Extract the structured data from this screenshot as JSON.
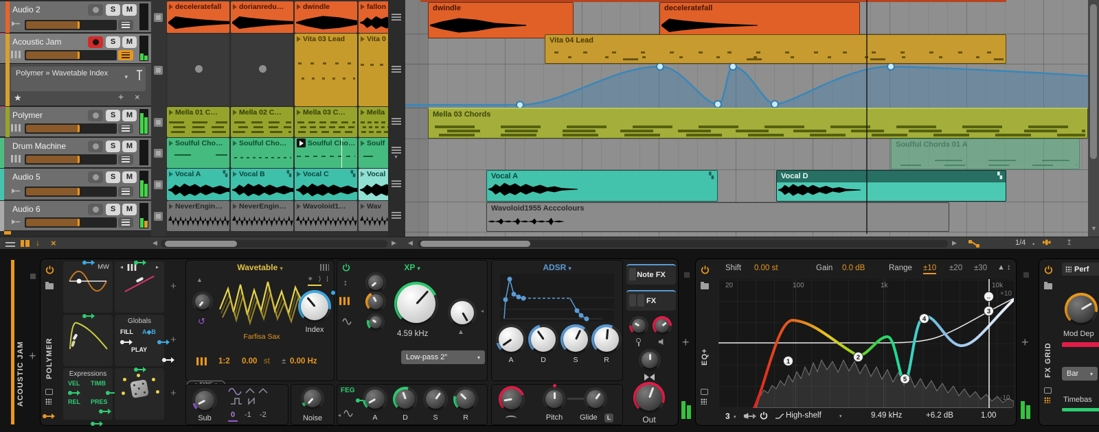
{
  "colors": {
    "accent_orange": "#e8981e",
    "accent_green": "#2ecc71",
    "accent_blue": "#3fa9e0",
    "accent_red": "#e11d48",
    "group_pink": "#d6336c",
    "track_audio2": "#e8642b",
    "track_acoustic": "#d89e2e",
    "track_polymer": "#97a42c",
    "track_drum": "#4dbd82",
    "track_audio5": "#45c4ae",
    "track_audio6": "#ababab"
  },
  "track_buttons": {
    "solo": "S",
    "mute": "M"
  },
  "tracks": [
    {
      "name": "Audio 2"
    },
    {
      "name": "Acoustic Jam"
    },
    {
      "name": "Polymer"
    },
    {
      "name": "Drum Machine"
    },
    {
      "name": "Audio 5"
    },
    {
      "name": "Audio 6"
    }
  ],
  "automation_lane": {
    "target": "Polymer » Wavetable Index"
  },
  "launcher": {
    "rows": [
      {
        "c1": "deceleratefall",
        "c2": "dorianredu…",
        "c3": "dwindle",
        "c4": "fallon"
      },
      {
        "c1": "",
        "c2": "",
        "c3": "Vita 03 Lead",
        "c4": "Vita 0"
      },
      {
        "c1": "Mella 01 C…",
        "c2": "Mella 02 C…",
        "c3": "Mella 03 C…",
        "c4": "Mella"
      },
      {
        "c1": "Soulful Cho…",
        "c2": "Soulful Cho…",
        "c3": "Soulful Cho…",
        "c4": "Soulf"
      },
      {
        "c1": "Vocal A",
        "c2": "Vocal B",
        "c3": "Vocal C",
        "c4": "Vocal"
      },
      {
        "c1": "NeverEngin…",
        "c2": "NeverEngin…",
        "c3": "Wavoloid1…",
        "c4": "Wav"
      }
    ]
  },
  "arranger": {
    "audio2_clip1": "dwindle",
    "audio2_clip2": "deceleratefall",
    "acoustic_clip": "Vita 04 Lead",
    "polymer_clip": "Mella 03 Chords",
    "drum_clip": "Soulful Chords 01 A",
    "audio5_clip1": "Vocal A",
    "audio5_clip2": "Vocal D",
    "audio6_clip": "Wavoloid1955 Acccolours"
  },
  "transport": {
    "grid": "1/4"
  },
  "devices": {
    "track_label": "ACOUSTIC JAM",
    "polymer": {
      "name": "POLYMER",
      "mod_mw": "MW",
      "globals_title": "Globals",
      "fill": "FILL",
      "ab": "A◆B",
      "play": "PLAY",
      "expressions_title": "Expressions",
      "vel": "VEL",
      "timb": "TIMB",
      "rel": "REL",
      "pres": "PRES",
      "osc_type": "Wavetable",
      "wavetable_name": "Farfisa Sax",
      "index_label": "Index",
      "ratio": "1:2",
      "tune": "0.00",
      "tune_unit": "st",
      "detune_pm": "±",
      "detune": "0.00 Hz",
      "sync": "SYNC",
      "sub_label": "Sub",
      "oct0": "0",
      "oct1": "-1",
      "oct2": "-2",
      "noise_label": "Noise",
      "filter_type": "XP",
      "cutoff": "4.59 kHz",
      "filter_mode": "Low-pass 2″",
      "feg_label": "FEG",
      "env_type": "ADSR",
      "a": "A",
      "d": "D",
      "s": "S",
      "r": "R",
      "pitch_label": "Pitch",
      "glide_label": "Glide",
      "glide_badge": "L",
      "note_fx": "Note FX",
      "fx": "FX",
      "out_label": "Out"
    },
    "eq": {
      "name": "EQ+",
      "shift_label": "Shift",
      "shift_value": "0.00 st",
      "gain_label": "Gain",
      "gain_value": "0.0 dB",
      "range_label": "Range",
      "range_10": "±10",
      "range_20": "±20",
      "range_30": "±30",
      "f20": "20",
      "f100": "100",
      "f1k": "1k",
      "f10k": "10k",
      "db_top": "+10",
      "db_bot": "-10",
      "band_select": "3",
      "band_type": "High-shelf",
      "freq_value": "9.49 kHz",
      "gain_db": "+6.2 dB",
      "q_value": "1.00",
      "b1": "1",
      "b2": "2",
      "b3": "3",
      "b4": "4",
      "b5": "5",
      "b3_arrows": "↔"
    },
    "fxgrid": {
      "name": "FX GRID",
      "header": "Perf",
      "mod_label": "Mod Dep",
      "bar": "Bar",
      "timebase": "Timebas"
    }
  }
}
